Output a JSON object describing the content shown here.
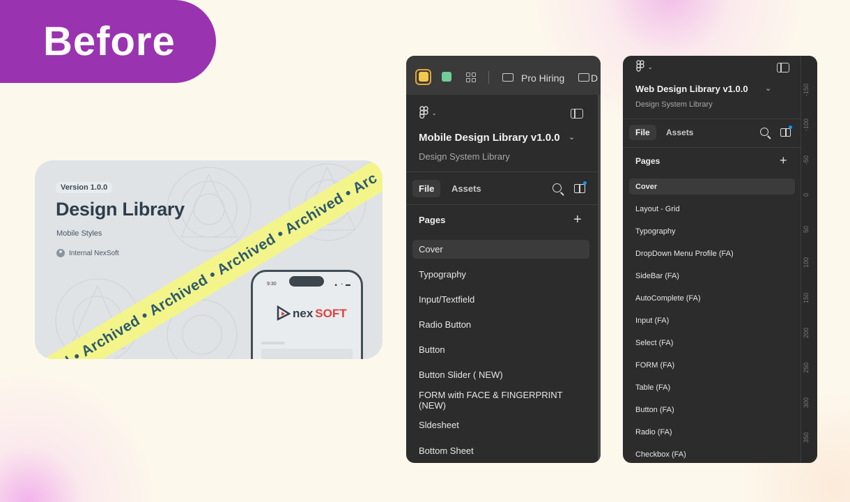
{
  "badge": {
    "label": "Before"
  },
  "colors": {
    "badge": "#9a33b0",
    "ribbon": "#f3f58a",
    "panel": "#2c2c2c"
  },
  "cover": {
    "version": "Version 1.0.0",
    "title": "Design Library",
    "subtitle": "Mobile Styles",
    "owner": "Internal NexSoft",
    "ribbon": "ed  •  Archived  •  Archived  •  Archived  •  Archived  •  Arc",
    "phone": {
      "time": "9:30",
      "signal": "▴ ◔ ▬",
      "logo_nex": "nex",
      "logo_soft": "SOFT"
    }
  },
  "panel1": {
    "breadcrumb": "Pro Hiring",
    "breadcrumb_next": "D",
    "file_title": "Mobile Design Library v1.0.0",
    "file_subtitle": "Design System Library",
    "tabs": [
      "File",
      "Assets"
    ],
    "pages_heading": "Pages",
    "pages": [
      "Cover",
      "Typography",
      "Input/Textfield",
      "Radio Button",
      "Button",
      "Button Slider ( NEW)",
      "FORM with FACE & FINGERPRINT (NEW)",
      "Sldesheet",
      "Bottom Sheet"
    ]
  },
  "panel2": {
    "file_title": "Web Design Library v1.0.0",
    "file_subtitle": "Design System Library",
    "tabs": [
      "File",
      "Assets"
    ],
    "pages_heading": "Pages",
    "pages": [
      "Cover",
      "Layout - Grid",
      "Typography",
      "DropDown Menu Profile (FA)",
      "SideBar (FA)",
      "AutoComplete (FA)",
      "Input (FA)",
      "Select (FA)",
      "FORM (FA)",
      "Table (FA)",
      "Button (FA)",
      "Radio (FA)",
      "Checkbox (FA)"
    ],
    "ruler": [
      "-150",
      "-100",
      "-50",
      "0",
      "50",
      "100",
      "150",
      "200",
      "250",
      "300",
      "350"
    ]
  }
}
